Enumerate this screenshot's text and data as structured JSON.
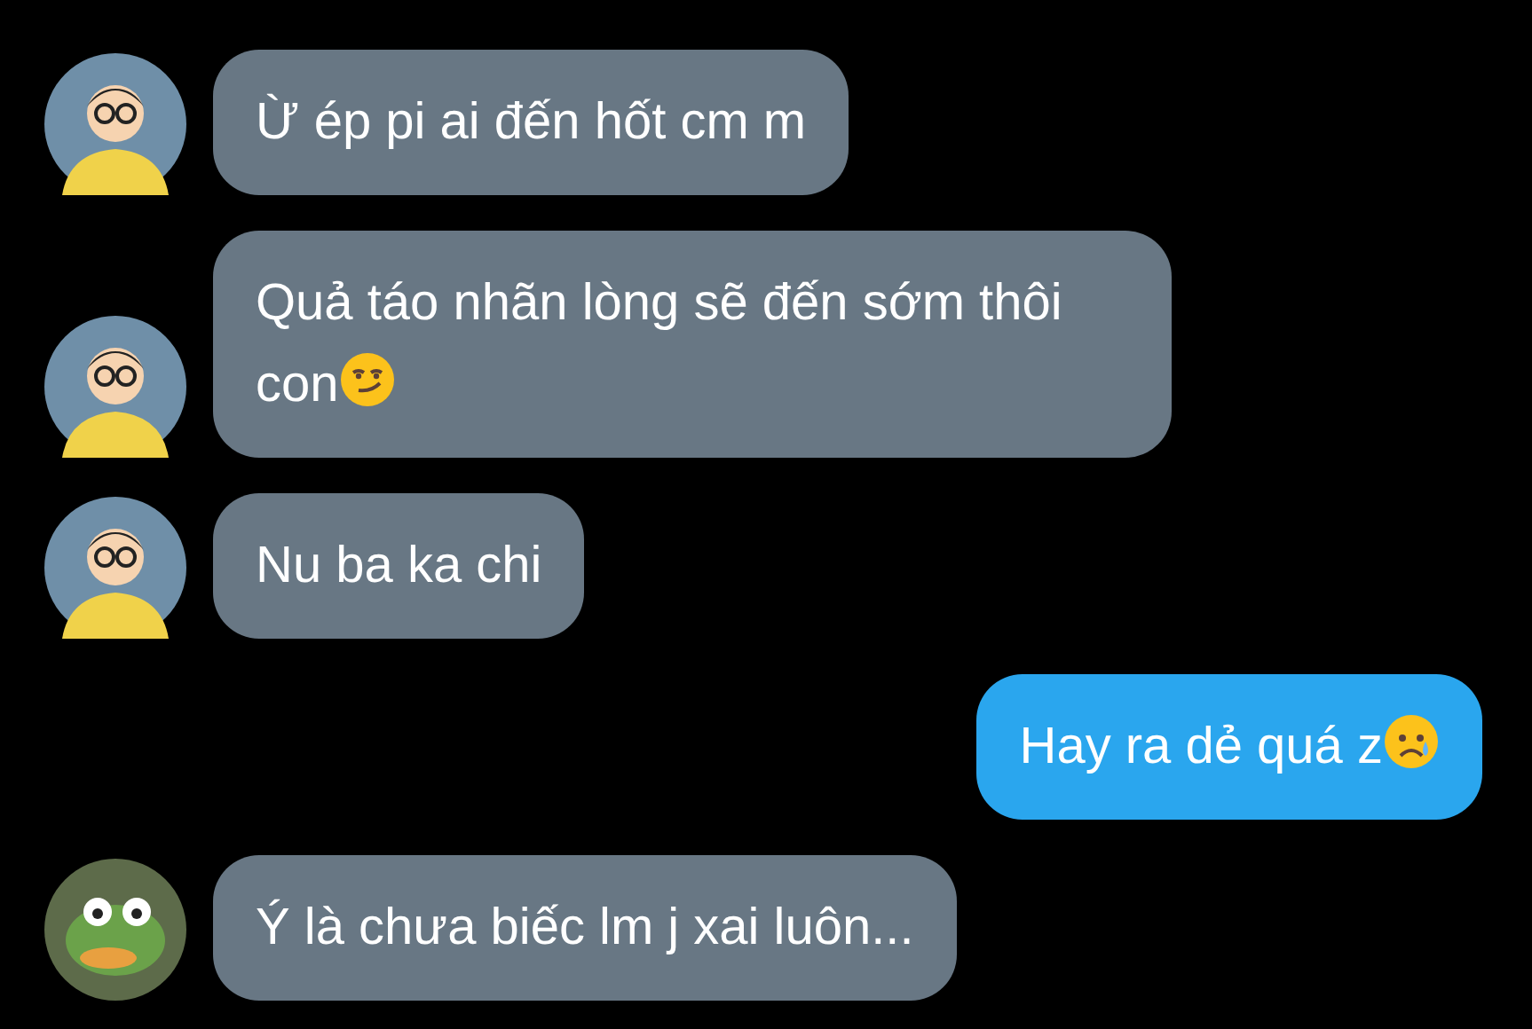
{
  "messages": [
    {
      "kind": "received",
      "avatar": {
        "kind": "boy"
      },
      "text": "Ừ ép pi ai đến hốt cm m"
    },
    {
      "kind": "received",
      "avatar": {
        "kind": "boy"
      },
      "text": "Quả táo nhãn lòng sẽ đến sớm thôi con",
      "emoji": {
        "kind": "smirk"
      }
    },
    {
      "kind": "received",
      "avatar": {
        "kind": "boy"
      },
      "text": "Nu ba ka chi"
    },
    {
      "kind": "sent",
      "text": "Hay ra dẻ quá z",
      "emoji": {
        "kind": "sad"
      }
    },
    {
      "kind": "received",
      "avatar": {
        "kind": "frog"
      },
      "text": "Ý là chưa biếc lm j xai luôn..."
    }
  ]
}
